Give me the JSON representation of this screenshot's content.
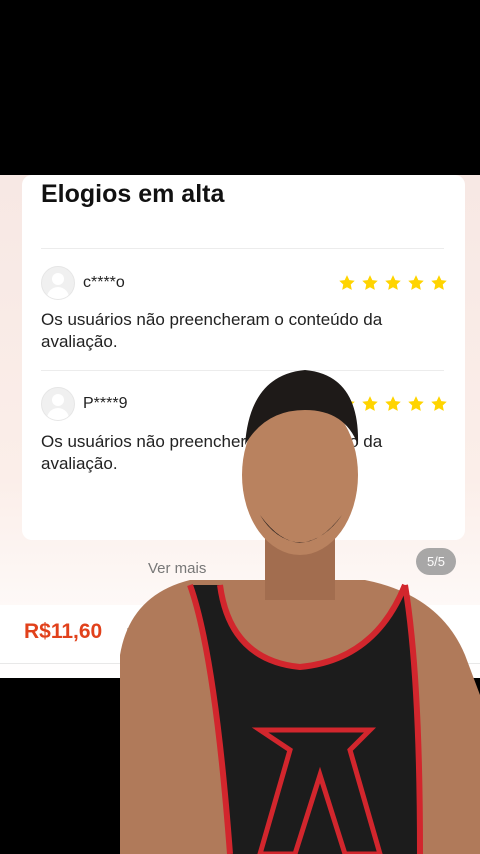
{
  "section": {
    "title": "Elogios em alta"
  },
  "reviews": [
    {
      "user": "c****o",
      "rating": 5,
      "text": "Os usuários não preencheram o conteúdo da avaliação."
    },
    {
      "user": "P****9",
      "rating": 5,
      "text": "Os usuários não preencheram o conteúdo da avaliação."
    }
  ],
  "footer": {
    "see_more": "Ver mais",
    "pager": "5/5"
  },
  "bottom_bar": {
    "price": "R$11,60",
    "price_sub": "R"
  },
  "colors": {
    "star": "#ffd400",
    "price": "#e1411b",
    "overlay_skin": "#b07a5a",
    "tank_top": "#1c1c1c",
    "tank_trim": "#d2262d"
  }
}
